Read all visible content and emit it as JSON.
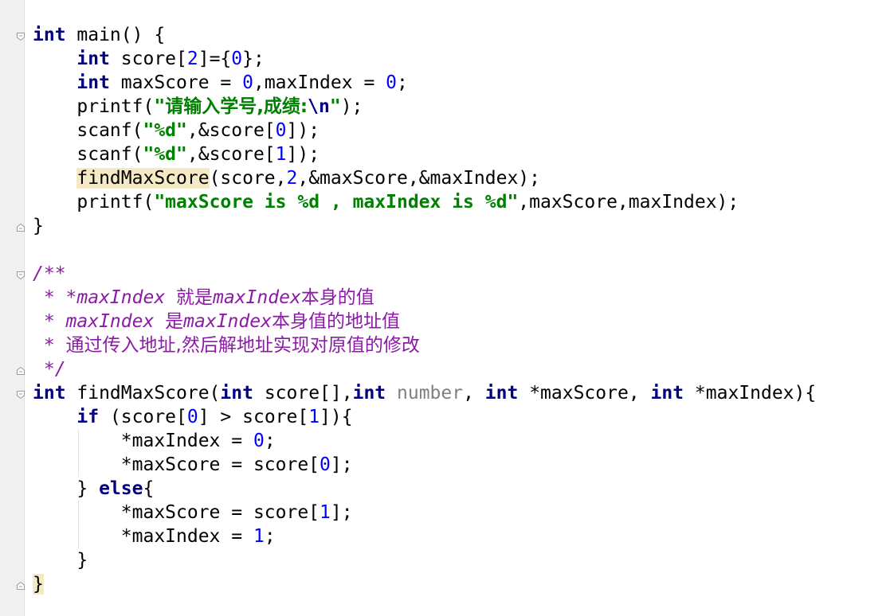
{
  "editor": {
    "lines": [
      [
        {
          "t": "int",
          "c": "kw"
        },
        {
          "t": " main() {",
          "c": ""
        }
      ],
      [
        {
          "t": "    ",
          "c": ""
        },
        {
          "t": "int",
          "c": "kw"
        },
        {
          "t": " score[",
          "c": ""
        },
        {
          "t": "2",
          "c": "num"
        },
        {
          "t": "]={",
          "c": ""
        },
        {
          "t": "0",
          "c": "num"
        },
        {
          "t": "};",
          "c": ""
        }
      ],
      [
        {
          "t": "    ",
          "c": ""
        },
        {
          "t": "int",
          "c": "kw"
        },
        {
          "t": " maxScore = ",
          "c": ""
        },
        {
          "t": "0",
          "c": "num"
        },
        {
          "t": ",maxIndex = ",
          "c": ""
        },
        {
          "t": "0",
          "c": "num"
        },
        {
          "t": ";",
          "c": ""
        }
      ],
      [
        {
          "t": "    printf(",
          "c": ""
        },
        {
          "t": "\"",
          "c": "str"
        },
        {
          "t": "请输入学号,成绩:",
          "c": "str-cjk"
        },
        {
          "t": "\\n",
          "c": "esc"
        },
        {
          "t": "\"",
          "c": "str"
        },
        {
          "t": ");",
          "c": ""
        }
      ],
      [
        {
          "t": "    scanf(",
          "c": ""
        },
        {
          "t": "\"%d\"",
          "c": "str"
        },
        {
          "t": ",&score[",
          "c": ""
        },
        {
          "t": "0",
          "c": "num"
        },
        {
          "t": "]);",
          "c": ""
        }
      ],
      [
        {
          "t": "    scanf(",
          "c": ""
        },
        {
          "t": "\"%d\"",
          "c": "str"
        },
        {
          "t": ",&score[",
          "c": ""
        },
        {
          "t": "1",
          "c": "num"
        },
        {
          "t": "]);",
          "c": ""
        }
      ],
      [
        {
          "t": "    ",
          "c": ""
        },
        {
          "t": "findMaxScore",
          "c": "hl-usage"
        },
        {
          "t": "(score,",
          "c": ""
        },
        {
          "t": "2",
          "c": "num"
        },
        {
          "t": ",&maxScore,&maxIndex);",
          "c": ""
        }
      ],
      [
        {
          "t": "    printf(",
          "c": ""
        },
        {
          "t": "\"maxScore is %d , maxIndex is %d\"",
          "c": "str"
        },
        {
          "t": ",maxScore,maxIndex);",
          "c": ""
        }
      ],
      [
        {
          "t": "}",
          "c": ""
        }
      ],
      [
        {
          "t": "",
          "c": ""
        }
      ],
      [
        {
          "t": "/**",
          "c": "cmt"
        }
      ],
      [
        {
          "t": " * *maxIndex ",
          "c": "cmt"
        },
        {
          "t": "就是",
          "c": "cmt-cjk"
        },
        {
          "t": "maxIndex",
          "c": "cmt"
        },
        {
          "t": "本身的值",
          "c": "cmt-cjk"
        }
      ],
      [
        {
          "t": " * maxIndex ",
          "c": "cmt"
        },
        {
          "t": "是",
          "c": "cmt-cjk"
        },
        {
          "t": "maxIndex",
          "c": "cmt"
        },
        {
          "t": "本身值的地址值",
          "c": "cmt-cjk"
        }
      ],
      [
        {
          "t": " * ",
          "c": "cmt"
        },
        {
          "t": "通过传入地址,然后解地址实现对原值的修改",
          "c": "cmt-cjk"
        }
      ],
      [
        {
          "t": " */",
          "c": "cmt"
        }
      ],
      [
        {
          "t": "int",
          "c": "kw"
        },
        {
          "t": " findMaxScore(",
          "c": ""
        },
        {
          "t": "int",
          "c": "kw"
        },
        {
          "t": " score[],",
          "c": ""
        },
        {
          "t": "int",
          "c": "kw"
        },
        {
          "t": " ",
          "c": ""
        },
        {
          "t": "number",
          "c": "param-unused"
        },
        {
          "t": ", ",
          "c": ""
        },
        {
          "t": "int",
          "c": "kw"
        },
        {
          "t": " *maxScore, ",
          "c": ""
        },
        {
          "t": "int",
          "c": "kw"
        },
        {
          "t": " *maxIndex){",
          "c": ""
        }
      ],
      [
        {
          "t": "    ",
          "c": ""
        },
        {
          "t": "if",
          "c": "kw"
        },
        {
          "t": " (score[",
          "c": ""
        },
        {
          "t": "0",
          "c": "num"
        },
        {
          "t": "] > score[",
          "c": ""
        },
        {
          "t": "1",
          "c": "num"
        },
        {
          "t": "]){",
          "c": ""
        }
      ],
      [
        {
          "t": "        *maxIndex = ",
          "c": ""
        },
        {
          "t": "0",
          "c": "num"
        },
        {
          "t": ";",
          "c": ""
        }
      ],
      [
        {
          "t": "        *maxScore = score[",
          "c": ""
        },
        {
          "t": "0",
          "c": "num"
        },
        {
          "t": "];",
          "c": ""
        }
      ],
      [
        {
          "t": "    } ",
          "c": ""
        },
        {
          "t": "else",
          "c": "kw"
        },
        {
          "t": "{",
          "c": ""
        }
      ],
      [
        {
          "t": "        *maxScore = score[",
          "c": ""
        },
        {
          "t": "1",
          "c": "num"
        },
        {
          "t": "];",
          "c": ""
        }
      ],
      [
        {
          "t": "        *maxIndex = ",
          "c": ""
        },
        {
          "t": "1",
          "c": "num"
        },
        {
          "t": ";",
          "c": ""
        }
      ],
      [
        {
          "t": "    }",
          "c": ""
        }
      ],
      [
        {
          "t": "}",
          "c": "hl-usage"
        }
      ]
    ],
    "folds": [
      {
        "line": 0,
        "kind": "open"
      },
      {
        "line": 8,
        "kind": "close"
      },
      {
        "line": 10,
        "kind": "open"
      },
      {
        "line": 14,
        "kind": "close"
      },
      {
        "line": 15,
        "kind": "open"
      },
      {
        "line": 23,
        "kind": "close"
      }
    ],
    "guides": [
      {
        "from": 17,
        "to": 18
      },
      {
        "from": 20,
        "to": 21
      }
    ],
    "colors": {
      "keyword": "#000080",
      "number": "#0000ff",
      "string": "#008000",
      "comment": "#8c1aa8",
      "highlight": "#f6eac6",
      "gutter": "#f0f0f0"
    }
  }
}
